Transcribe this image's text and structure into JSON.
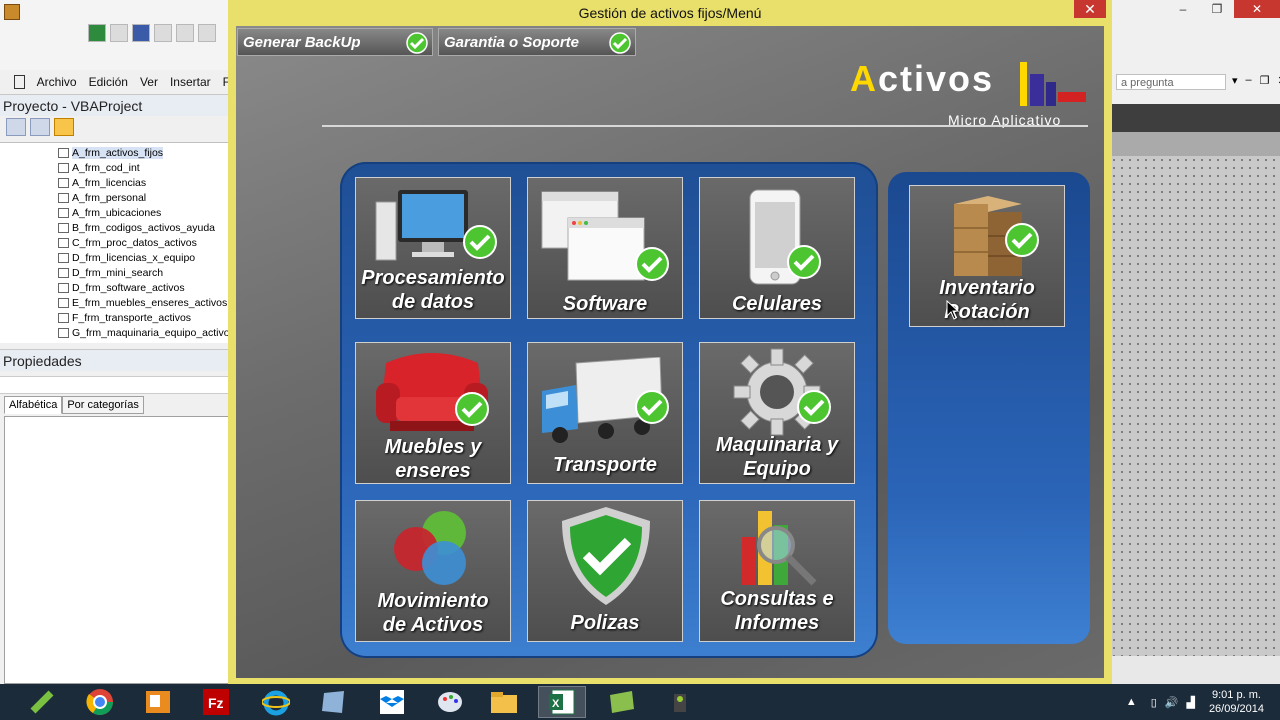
{
  "vba": {
    "menu": [
      "Archivo",
      "Edición",
      "Ver",
      "Insertar",
      "F"
    ],
    "project_title": "Proyecto - VBAProject",
    "tree_items": [
      "A_frm_activos_fijos",
      "A_frm_cod_int",
      "A_frm_licencias",
      "A_frm_personal",
      "A_frm_ubicaciones",
      "B_frm_codigos_activos_ayuda",
      "C_frm_proc_datos_activos",
      "D_frm_licencias_x_equipo",
      "D_frm_mini_search",
      "D_frm_software_activos",
      "E_frm_muebles_enseres_activos",
      "F_frm_transporte_activos",
      "G_frm_maquinaria_equipo_activos"
    ],
    "properties_title": "Propiedades",
    "tabs": [
      "Alfabética",
      "Por categorías"
    ],
    "ask_placeholder": "a pregunta"
  },
  "dialog": {
    "title": "Gestión de activos fijos/Menú",
    "close": "✕",
    "top_buttons": [
      "Generar BackUp",
      "Garantia o Soporte"
    ],
    "logo": {
      "word_first": "A",
      "word_rest": "ctivos",
      "subtitle": "Micro Aplicativo"
    },
    "tiles": {
      "procesamiento": [
        "Procesamiento",
        "de datos"
      ],
      "software": [
        "Software"
      ],
      "celulares": [
        "Celulares"
      ],
      "muebles": [
        "Muebles y",
        "enseres"
      ],
      "transporte": [
        "Transporte"
      ],
      "maquinaria": [
        "Maquinaria y",
        "Equipo"
      ],
      "movimiento": [
        "Movimiento",
        "de Activos"
      ],
      "polizas": [
        "Polizas"
      ],
      "consultas": [
        "Consultas e",
        "Informes"
      ],
      "inventario": [
        "Inventario",
        "Rotación"
      ]
    }
  },
  "taskbar": {
    "time": "9:01 p. m.",
    "date": "26/09/2014"
  },
  "colors": {
    "dialog_frame": "#e8e06a",
    "panel_blue": "#2a63b5",
    "check_green": "#4cc531",
    "taskbar": "#1b2b3a"
  }
}
